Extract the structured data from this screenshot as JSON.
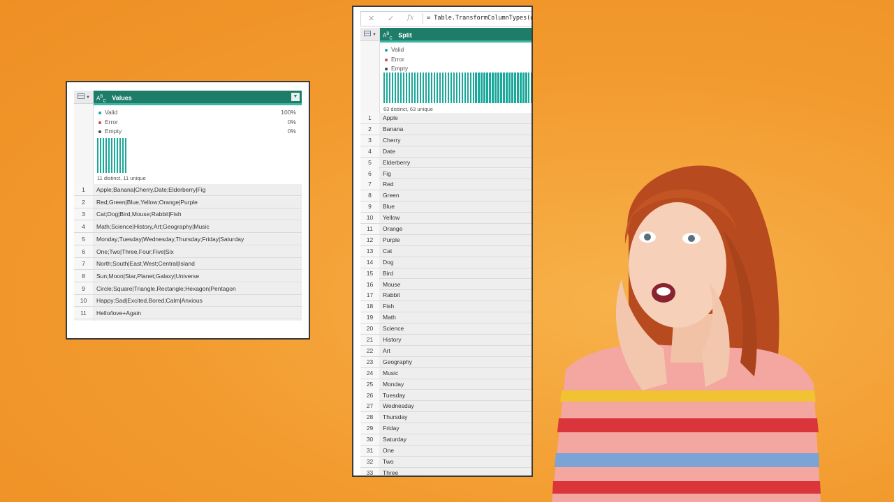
{
  "colors": {
    "header": "#1d7d69",
    "bars": "#1aa89b",
    "valid_dot": "#1aa89b",
    "error_dot": "#e0443b",
    "empty_dot": "#444444",
    "background": "#f29a2e"
  },
  "left": {
    "column_title": "Values",
    "type_icon": "ABC",
    "dropdown_icon": "chevron-down-icon",
    "profile": [
      {
        "label": "Valid",
        "pct": "100%"
      },
      {
        "label": "Error",
        "pct": "0%"
      },
      {
        "label": "Empty",
        "pct": "0%"
      }
    ],
    "bar_count": 11,
    "distinct_text": "11 distinct, 11 unique",
    "rows": [
      {
        "n": "1",
        "v": "Apple;Banana|Cherry,Date;Elderberry|Fig"
      },
      {
        "n": "2",
        "v": "Red;Green|Blue,Yellow;Orange|Purple"
      },
      {
        "n": "3",
        "v": "Cat;Dog|Bird,Mouse;Rabbit|Fish"
      },
      {
        "n": "4",
        "v": "Math;Science|History,Art;Geography|Music"
      },
      {
        "n": "5",
        "v": "Monday;Tuesday|Wednesday,Thursday;Friday|Saturday"
      },
      {
        "n": "6",
        "v": "One;Two|Three,Four;Five|Six"
      },
      {
        "n": "7",
        "v": "North;South|East,West;Central|Island"
      },
      {
        "n": "8",
        "v": "Sun;Moon|Star,Planet;Galaxy|Universe"
      },
      {
        "n": "9",
        "v": "Circle;Square|Triangle,Rectangle;Hexagon|Pentagon"
      },
      {
        "n": "10",
        "v": "Happy;Sad|Excited,Bored;Calm|Anxious"
      },
      {
        "n": "11",
        "v": "Hello/love+Again"
      }
    ]
  },
  "right": {
    "formula_cancel": "✕",
    "formula_confirm": "✓",
    "formula_fx": "fx",
    "formula_text": "= Table.TransformColumnTypes(#",
    "column_title": "Split",
    "type_icon": "ABC",
    "profile": [
      {
        "label": "Valid"
      },
      {
        "label": "Error"
      },
      {
        "label": "Empty"
      }
    ],
    "bar_count": 63,
    "distinct_text": "63 distinct, 63 unique",
    "rows": [
      {
        "n": "1",
        "v": "Apple"
      },
      {
        "n": "2",
        "v": "Banana"
      },
      {
        "n": "3",
        "v": "Cherry"
      },
      {
        "n": "4",
        "v": "Date"
      },
      {
        "n": "5",
        "v": "Elderberry"
      },
      {
        "n": "6",
        "v": "Fig"
      },
      {
        "n": "7",
        "v": "Red"
      },
      {
        "n": "8",
        "v": "Green"
      },
      {
        "n": "9",
        "v": "Blue"
      },
      {
        "n": "10",
        "v": "Yellow"
      },
      {
        "n": "11",
        "v": "Orange"
      },
      {
        "n": "12",
        "v": "Purple"
      },
      {
        "n": "13",
        "v": "Cat"
      },
      {
        "n": "14",
        "v": "Dog"
      },
      {
        "n": "15",
        "v": "Bird"
      },
      {
        "n": "16",
        "v": "Mouse"
      },
      {
        "n": "17",
        "v": "Rabbit"
      },
      {
        "n": "18",
        "v": "Fish"
      },
      {
        "n": "19",
        "v": "Math"
      },
      {
        "n": "20",
        "v": "Science"
      },
      {
        "n": "21",
        "v": "History"
      },
      {
        "n": "22",
        "v": "Art"
      },
      {
        "n": "23",
        "v": "Geography"
      },
      {
        "n": "24",
        "v": "Music"
      },
      {
        "n": "25",
        "v": "Monday"
      },
      {
        "n": "26",
        "v": "Tuesday"
      },
      {
        "n": "27",
        "v": "Wednesday"
      },
      {
        "n": "28",
        "v": "Thursday"
      },
      {
        "n": "29",
        "v": "Friday"
      },
      {
        "n": "30",
        "v": "Saturday"
      },
      {
        "n": "31",
        "v": "One"
      },
      {
        "n": "32",
        "v": "Two"
      },
      {
        "n": "33",
        "v": "Three"
      }
    ]
  }
}
